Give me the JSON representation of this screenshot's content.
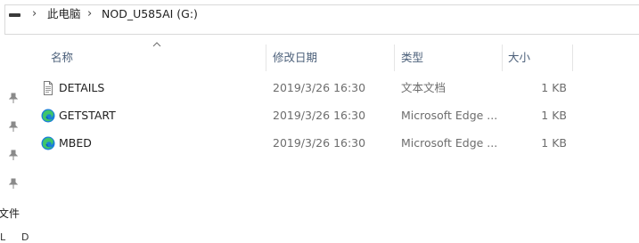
{
  "address": {
    "breadcrumb": [
      "此电脑",
      "NOD_U585AI (G:)"
    ]
  },
  "columns": {
    "name": "名称",
    "date": "修改日期",
    "type": "类型",
    "size": "大小"
  },
  "files": [
    {
      "name": "DETAILS",
      "date": "2019/3/26 16:30",
      "type": "文本文档",
      "size": "1 KB",
      "icon": "text-document-icon"
    },
    {
      "name": "GETSTART",
      "date": "2019/3/26 16:30",
      "type": "Microsoft Edge ...",
      "size": "1 KB",
      "icon": "microsoft-edge-icon"
    },
    {
      "name": "MBED",
      "date": "2019/3/26 16:30",
      "type": "Microsoft Edge ...",
      "size": "1 KB",
      "icon": "microsoft-edge-icon"
    }
  ],
  "nav": {
    "partial_label": "文件",
    "cut_labels": [
      "L",
      "D"
    ]
  },
  "colors": {
    "header_text": "#4c607a",
    "meta_text": "#6d6d6d",
    "edge_blue": "#1a7fd9",
    "edge_green": "#3fc56a"
  }
}
